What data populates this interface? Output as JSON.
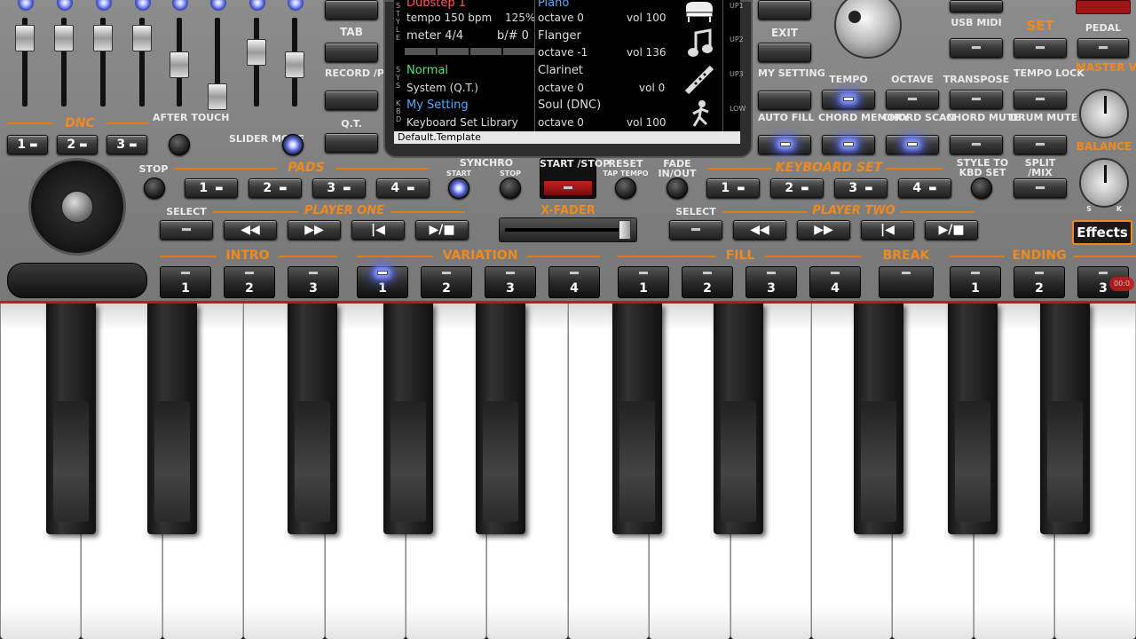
{
  "colors": {
    "accent": "#f08a1e",
    "led_on": "#8aa0ff",
    "screen_bg": "#000000"
  },
  "dnc": {
    "title": "DNC",
    "buttons": [
      "1",
      "2",
      "3"
    ]
  },
  "after_touch_label": "AFTER TOUCH",
  "slider_mode_label": "SLIDER MODE",
  "center_left": {
    "tab": "TAB",
    "record_play": "RECORD /PLAY",
    "qt": "Q.T."
  },
  "display": {
    "style_side": "S T Y L E",
    "sys_side": "S Y S",
    "kbd_side": "K B D",
    "style_name": "Dubstep 1",
    "tempo": "tempo 150 bpm",
    "tempo_pct": "125%",
    "meter": "meter 4/4",
    "bsharp": "b/# 0",
    "sys_name": "Normal",
    "sys_sub": "System (Q.T.)",
    "kbd_name": "My Setting",
    "kbd_sub": "Keyboard Set Library",
    "template": "Default.Template",
    "upper_side": [
      "UP1",
      "UP2",
      "UP3",
      "LOW"
    ],
    "parts": [
      {
        "name": "Piano",
        "octave": "octave  0",
        "vol": "vol 100",
        "icon": "grand-piano-icon"
      },
      {
        "name": "Flanger",
        "octave": "octave -1",
        "vol": "vol 136",
        "icon": "music-note-icon"
      },
      {
        "name": "Clarinet",
        "octave": "octave  0",
        "vol": "vol 0",
        "icon": "clarinet-icon"
      },
      {
        "name": "Soul (DNC)",
        "octave": "octave  0",
        "vol": "vol 100",
        "icon": "dancer-icon"
      }
    ]
  },
  "center_right": {
    "exit": "EXIT",
    "my_setting": "MY SETTING",
    "auto_fill": "AUTO FILL"
  },
  "right_top": {
    "usb_midi": "USB MIDI",
    "set": "SET",
    "pedal": "PEDAL",
    "tempo": "TEMPO",
    "octave": "OCTAVE",
    "transpose": "TRANSPOSE",
    "tempo_lock": "TEMPO LOCK",
    "chord_memory": "CHORD MEMORY",
    "chord_scan": "CHORD SCAN",
    "chord_mute": "CHORD MUTE",
    "drum_mute": "DRUM MUTE",
    "master_volume": "MASTER VOLUME",
    "balance": "BALANCE",
    "bal_s": "S",
    "bal_k": "K"
  },
  "pads": {
    "stop": "STOP",
    "title": "PADS",
    "buttons": [
      "1",
      "2",
      "3",
      "4"
    ]
  },
  "synchro": {
    "title": "SYNCHRO",
    "start": "START",
    "stop": "STOP"
  },
  "start_stop": "START /STOP",
  "reset": {
    "title": "RESET",
    "sub": "TAP TEMPO"
  },
  "fade": "FADE IN/OUT",
  "keyboard_set": {
    "title": "KEYBOARD SET",
    "buttons": [
      "1",
      "2",
      "3",
      "4"
    ]
  },
  "style_to_kbd": "STYLE TO KBD SET",
  "split_mix": "SPLIT /MIX",
  "player_one": {
    "select": "SELECT",
    "title": "PLAYER ONE"
  },
  "x_fader": "X-FADER",
  "player_two": {
    "select": "SELECT",
    "title": "PLAYER TWO"
  },
  "effects": "Effects",
  "sections": {
    "intro": {
      "title": "INTRO",
      "buttons": [
        "1",
        "2",
        "3"
      ]
    },
    "variation": {
      "title": "VARIATION",
      "buttons": [
        "1",
        "2",
        "3",
        "4"
      ]
    },
    "fill": {
      "title": "FILL",
      "buttons": [
        "1",
        "2",
        "3",
        "4"
      ]
    },
    "break": {
      "title": "BREAK"
    },
    "ending": {
      "title": "ENDING",
      "buttons": [
        "1",
        "2",
        "3"
      ]
    }
  },
  "rec_time": "00:0"
}
